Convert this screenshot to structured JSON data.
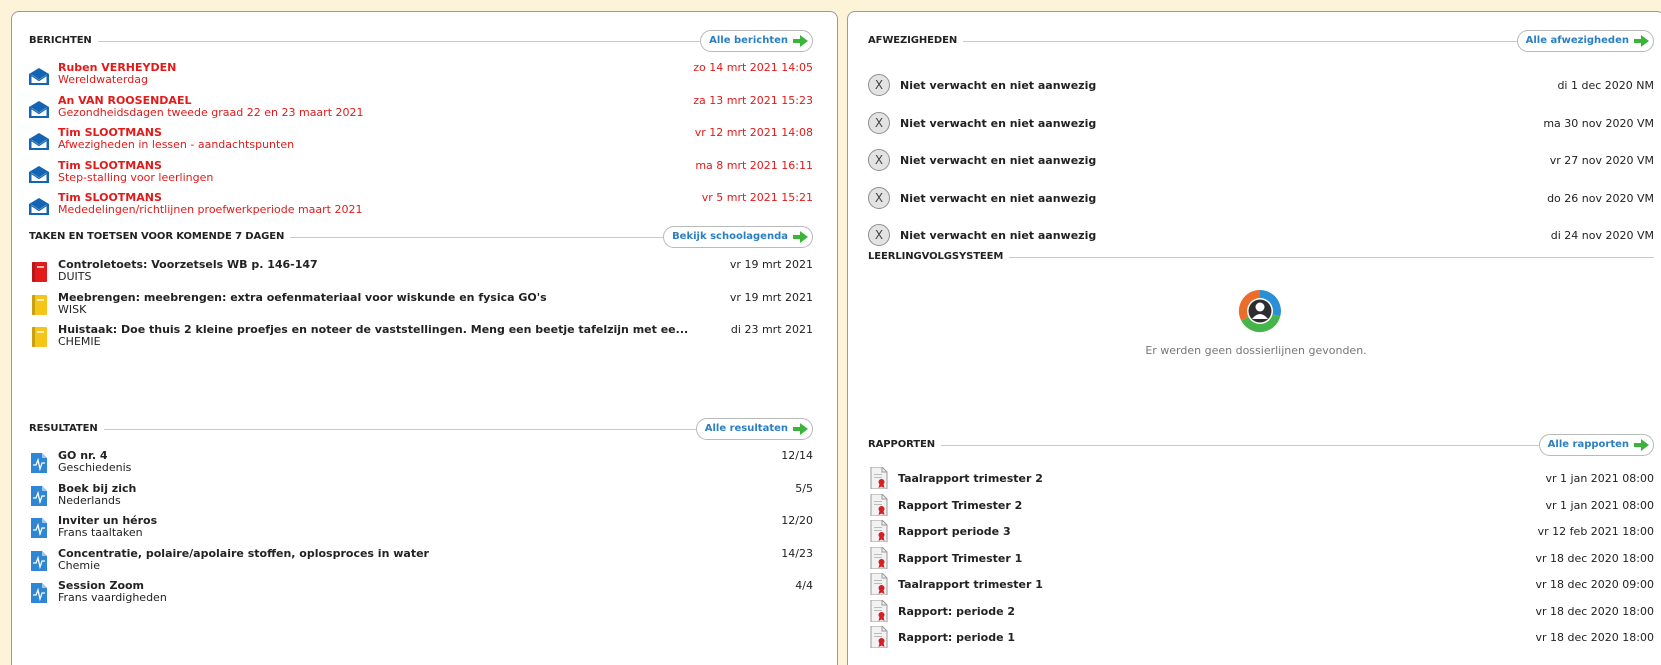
{
  "berichten": {
    "title": "BERICHTEN",
    "button_label": "Alle berichten",
    "items": [
      {
        "sender": "Ruben VERHEYDEN",
        "subject": "Wereldwaterdag",
        "date": "zo 14 mrt 2021 14:05"
      },
      {
        "sender": "An VAN ROOSENDAEL",
        "subject": "Gezondheidsdagen tweede graad 22 en 23 maart 2021",
        "date": "za 13 mrt 2021 15:23"
      },
      {
        "sender": "Tim SLOOTMANS",
        "subject": "Afwezigheden in lessen - aandachtspunten",
        "date": "vr 12 mrt 2021 14:08"
      },
      {
        "sender": "Tim SLOOTMANS",
        "subject": "Step-stalling voor leerlingen",
        "date": "ma 8 mrt 2021 16:11"
      },
      {
        "sender": "Tim SLOOTMANS",
        "subject": "Mededelingen/richtlijnen proefwerkperiode maart 2021",
        "date": "vr 5 mrt 2021 15:21"
      }
    ]
  },
  "taken": {
    "title": "TAKEN EN TOETSEN VOOR KOMENDE 7 DAGEN",
    "button_label": "Bekijk schoolagenda",
    "items": [
      {
        "title": "Controletoets: Voorzetsels WB p. 146-147",
        "subject": "DUITS",
        "date": "vr 19 mrt 2021",
        "color": "#e31b1b"
      },
      {
        "title": "Meebrengen: meebrengen: extra oefenmateriaal voor wiskunde en fysica GO's",
        "subject": "WISK",
        "date": "vr 19 mrt 2021",
        "color": "#f5c518"
      },
      {
        "title": "Huistaak: Doe thuis 2 kleine proefjes en noteer de vaststellingen. Meng een beetje tafelzijn met ee...",
        "subject": "CHEMIE",
        "date": "di 23 mrt 2021",
        "color": "#f5c518"
      }
    ]
  },
  "resultaten": {
    "title": "RESULTATEN",
    "button_label": "Alle resultaten",
    "items": [
      {
        "title": "GO nr. 4",
        "subject": "Geschiedenis",
        "score": "12/14"
      },
      {
        "title": "Boek bij zich",
        "subject": "Nederlands",
        "score": "5/5"
      },
      {
        "title": "Inviter un héros",
        "subject": "Frans taaltaken",
        "score": "12/20"
      },
      {
        "title": "Concentratie, polaire/apolaire stoffen, oplosproces in water",
        "subject": "Chemie",
        "score": "14/23"
      },
      {
        "title": "Session Zoom",
        "subject": "Frans vaardigheden",
        "score": "4/4"
      }
    ]
  },
  "afwezigheden": {
    "title": "AFWEZIGHEDEN",
    "button_label": "Alle afwezigheden",
    "badge": "X",
    "items": [
      {
        "label": "Niet verwacht en niet aanwezig",
        "date": "di 1 dec 2020 NM"
      },
      {
        "label": "Niet verwacht en niet aanwezig",
        "date": "ma 30 nov 2020 VM"
      },
      {
        "label": "Niet verwacht en niet aanwezig",
        "date": "vr 27 nov 2020 VM"
      },
      {
        "label": "Niet verwacht en niet aanwezig",
        "date": "do 26 nov 2020 VM"
      },
      {
        "label": "Niet verwacht en niet aanwezig",
        "date": "di 24 nov 2020 VM"
      }
    ]
  },
  "lvs": {
    "title": "LEERLINGVOLGSYSTEEM",
    "empty_text": "Er werden geen dossierlijnen gevonden."
  },
  "rapporten": {
    "title": "RAPPORTEN",
    "button_label": "Alle rapporten",
    "items": [
      {
        "title": "Taalrapport trimester 2",
        "date": "vr 1 jan 2021 08:00"
      },
      {
        "title": "Rapport Trimester 2",
        "date": "vr 1 jan 2021 08:00"
      },
      {
        "title": "Rapport periode 3",
        "date": "vr 12 feb 2021 18:00"
      },
      {
        "title": "Rapport Trimester 1",
        "date": "vr 18 dec 2020 18:00"
      },
      {
        "title": "Taalrapport trimester 1",
        "date": "vr 18 dec 2020 09:00"
      },
      {
        "title": "Rapport: periode 2",
        "date": "vr 18 dec 2020 18:00"
      },
      {
        "title": "Rapport: periode 1",
        "date": "vr 18 dec 2020 18:00"
      }
    ]
  },
  "colors": {
    "accent_blue": "#2a7fc3",
    "message_red": "#e11a1a",
    "arrow_green": "#3cb43c",
    "background": "#fdf3d9"
  }
}
